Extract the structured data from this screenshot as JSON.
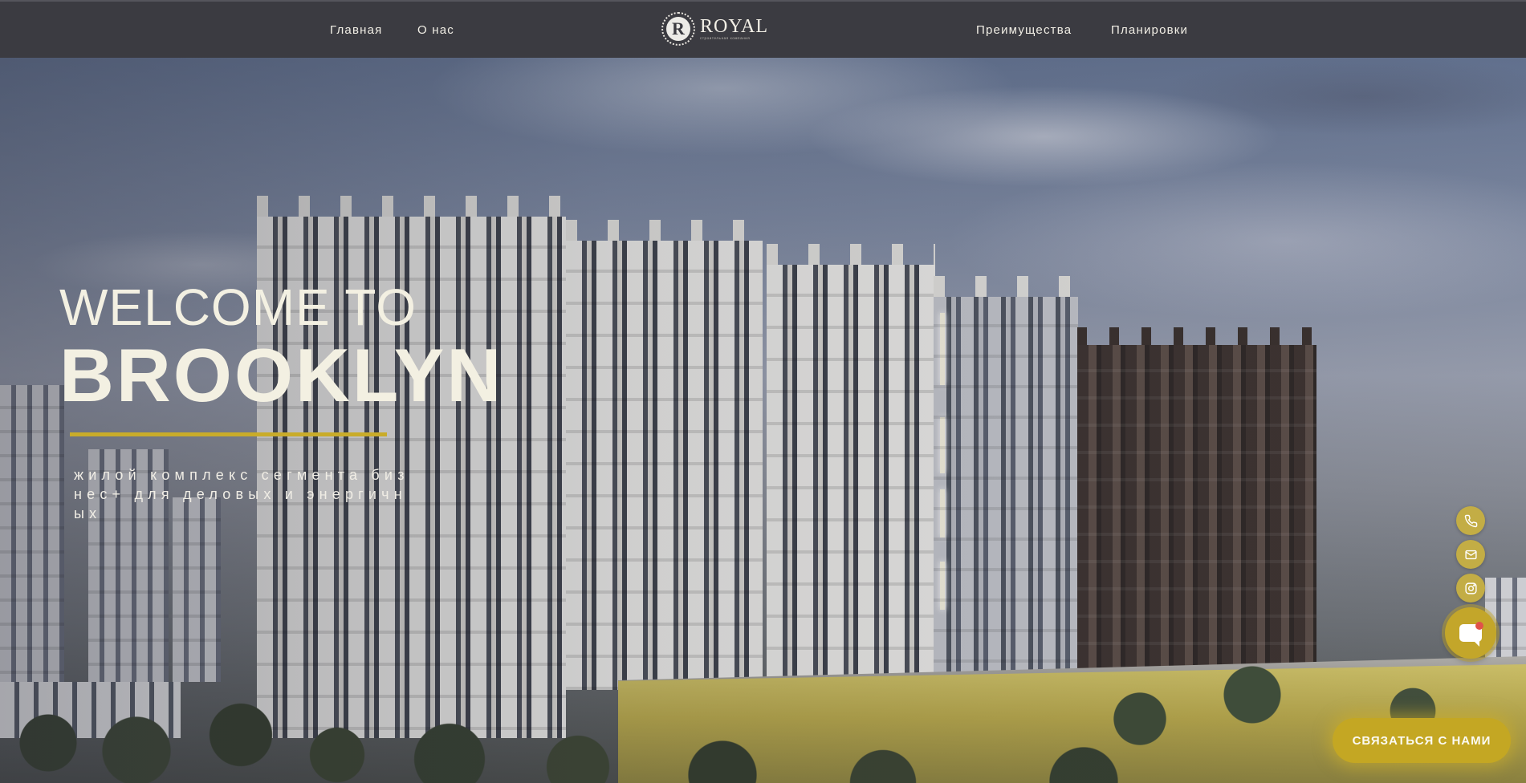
{
  "header": {
    "nav_left": [
      "Главная",
      "О нас"
    ],
    "nav_right": [
      "Преимущества",
      "Планировки"
    ],
    "logo": {
      "letter": "R",
      "name": "ROYAL",
      "subtitle": "строительная компания"
    }
  },
  "hero": {
    "welcome": "WELCOME TO",
    "title": "BROOKLYN",
    "tagline": "жилой комплекс сегмента бизнес+ для деловых и энергичных"
  },
  "contact": {
    "icons": [
      "phone-icon",
      "mail-icon",
      "instagram-icon"
    ],
    "chat_icon": "chat-icon",
    "cta_label": "СВЯЗАТЬСЯ С НАМИ"
  },
  "colors": {
    "header_bg": "#3b3b41",
    "accent_gold": "#c9ac2a",
    "text_light": "#f3f0e2"
  }
}
